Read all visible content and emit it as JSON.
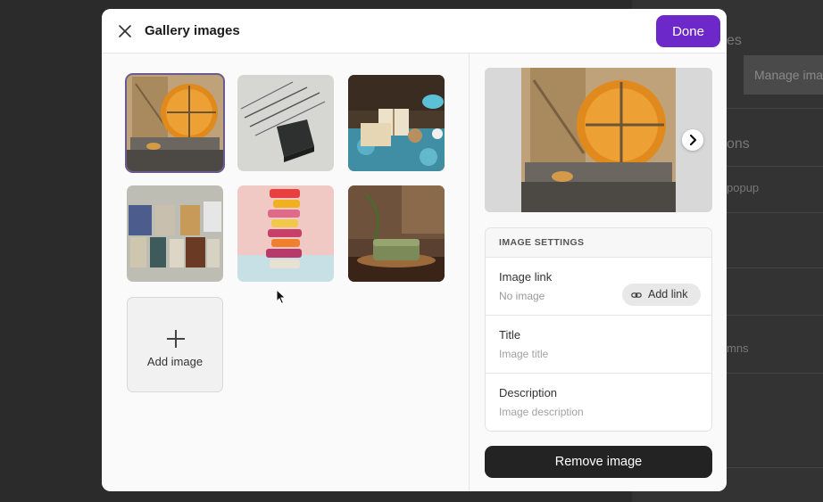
{
  "background": {
    "texts": [
      "es",
      "Manage ima",
      "ons",
      "popup",
      "mns"
    ]
  },
  "modal": {
    "title": "Gallery images",
    "done_label": "Done",
    "add_image_label": "Add image",
    "images": [
      {
        "name": "soap-stack-rope",
        "selected": true
      },
      {
        "name": "black-soap-twigs",
        "selected": false
      },
      {
        "name": "wrapped-soap-candles",
        "selected": false
      },
      {
        "name": "soap-bars-bottles",
        "selected": false
      },
      {
        "name": "colorful-soap-tower",
        "selected": false
      },
      {
        "name": "green-soap-wooden-tray",
        "selected": false
      }
    ]
  },
  "settings": {
    "heading": "IMAGE SETTINGS",
    "image_link": {
      "label": "Image link",
      "value": "No image",
      "button": "Add link"
    },
    "title": {
      "label": "Title",
      "placeholder": "Image title"
    },
    "description": {
      "label": "Description",
      "placeholder": "Image description"
    },
    "remove_label": "Remove image"
  },
  "colors": {
    "accent": "#6d28c9",
    "dark_button": "#232323"
  }
}
